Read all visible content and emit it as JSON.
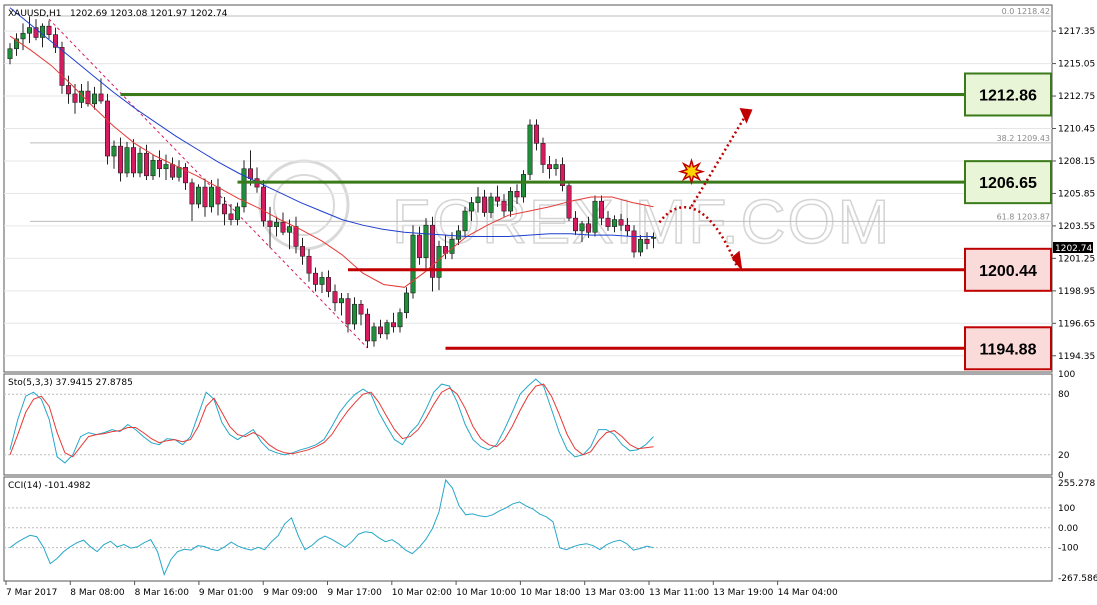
{
  "header": {
    "symbol": "XAUUSD,H1",
    "ohlc": "1202.69 1203.08 1201.97 1202.74",
    "current_price": "1202.74"
  },
  "watermark": "FOREXIMF.COM",
  "colors": {
    "bull": "#1f8f3a",
    "bear": "#d81b60",
    "ma_fast": "#e53935",
    "ma_slow": "#1e3fd0",
    "support": "#c00000",
    "resistance": "#3a7a1a",
    "stoch_main": "#26a7c9",
    "stoch_signal": "#e53935",
    "cci": "#26a7c9"
  },
  "levels": [
    {
      "label": "1212.86",
      "value": 1212.86,
      "kind": "resistance"
    },
    {
      "label": "1206.65",
      "value": 1206.65,
      "kind": "resistance"
    },
    {
      "label": "1200.44",
      "value": 1200.44,
      "kind": "support"
    },
    {
      "label": "1194.88",
      "value": 1194.88,
      "kind": "support"
    }
  ],
  "fib_labels": [
    {
      "text": "0.0  1218.42",
      "value": 1218.42
    },
    {
      "text": "38.2  1209.43",
      "value": 1209.43
    },
    {
      "text": "61.8  1203.87",
      "value": 1203.87
    }
  ],
  "stoch_header": "Sto(5,3,3) 37.9415 27.8785",
  "cci_header": "CCI(14) -101.4982",
  "x_ticks": [
    "7 Mar 2017",
    "8 Mar 08:00",
    "8 Mar 16:00",
    "9 Mar 01:00",
    "9 Mar 09:00",
    "9 Mar 17:00",
    "10 Mar 02:00",
    "10 Mar 10:00",
    "10 Mar 18:00",
    "13 Mar 03:00",
    "13 Mar 11:00",
    "13 Mar 19:00",
    "14 Mar 04:00"
  ],
  "chart_data": {
    "type": "candlestick",
    "symbol": "XAUUSD",
    "timeframe": "H1",
    "price_axis": {
      "ylim": [
        1193.2,
        1219.2
      ],
      "ticks": [
        "1217.35",
        "1215.05",
        "1212.75",
        "1210.45",
        "1208.15",
        "1205.85",
        "1203.55",
        "1201.25",
        "1198.95",
        "1196.65",
        "1194.35"
      ]
    },
    "candles": [
      [
        1215.4,
        1216.5,
        1215.0,
        1216.1
      ],
      [
        1216.1,
        1217.2,
        1215.6,
        1216.8
      ],
      [
        1216.8,
        1217.9,
        1216.0,
        1217.2
      ],
      [
        1217.2,
        1218.4,
        1216.5,
        1217.6
      ],
      [
        1217.6,
        1218.2,
        1216.7,
        1216.9
      ],
      [
        1216.9,
        1217.9,
        1216.2,
        1217.7
      ],
      [
        1217.7,
        1218.1,
        1216.8,
        1217.1
      ],
      [
        1217.1,
        1217.6,
        1215.8,
        1216.2
      ],
      [
        1216.2,
        1216.6,
        1212.9,
        1213.5
      ],
      [
        1213.5,
        1214.2,
        1212.2,
        1212.9
      ],
      [
        1212.9,
        1213.6,
        1211.5,
        1212.3
      ],
      [
        1212.3,
        1213.6,
        1211.9,
        1213.1
      ],
      [
        1213.1,
        1213.8,
        1212.0,
        1212.2
      ],
      [
        1212.2,
        1213.4,
        1211.8,
        1212.9
      ],
      [
        1212.9,
        1214.0,
        1212.2,
        1212.4
      ],
      [
        1212.4,
        1212.9,
        1207.9,
        1208.5
      ],
      [
        1208.5,
        1209.6,
        1207.6,
        1209.2
      ],
      [
        1209.2,
        1209.8,
        1206.7,
        1207.3
      ],
      [
        1207.3,
        1209.5,
        1207.0,
        1209.1
      ],
      [
        1209.1,
        1209.7,
        1207.0,
        1207.3
      ],
      [
        1207.3,
        1209.1,
        1207.0,
        1208.7
      ],
      [
        1208.7,
        1209.3,
        1206.8,
        1207.1
      ],
      [
        1207.1,
        1208.6,
        1206.8,
        1208.2
      ],
      [
        1208.2,
        1208.9,
        1207.0,
        1207.6
      ],
      [
        1207.6,
        1208.6,
        1206.8,
        1207.9
      ],
      [
        1207.9,
        1208.4,
        1206.8,
        1207.0
      ],
      [
        1207.0,
        1208.2,
        1206.7,
        1207.7
      ],
      [
        1207.7,
        1208.0,
        1206.1,
        1206.6
      ],
      [
        1206.6,
        1206.9,
        1203.9,
        1205.1
      ],
      [
        1205.1,
        1206.5,
        1204.8,
        1206.3
      ],
      [
        1206.3,
        1206.9,
        1204.2,
        1204.9
      ],
      [
        1204.9,
        1206.8,
        1204.5,
        1206.3
      ],
      [
        1206.3,
        1206.9,
        1204.3,
        1205.1
      ],
      [
        1205.1,
        1205.6,
        1203.6,
        1204.4
      ],
      [
        1204.4,
        1205.1,
        1203.6,
        1204.0
      ],
      [
        1204.0,
        1205.2,
        1203.6,
        1204.9
      ],
      [
        1204.9,
        1208.2,
        1204.5,
        1207.6
      ],
      [
        1207.6,
        1208.9,
        1206.4,
        1206.9
      ],
      [
        1206.9,
        1207.7,
        1205.9,
        1206.3
      ],
      [
        1206.3,
        1206.8,
        1203.5,
        1203.9
      ],
      [
        1203.9,
        1204.9,
        1202.0,
        1203.5
      ],
      [
        1203.5,
        1204.2,
        1202.8,
        1203.8
      ],
      [
        1203.8,
        1204.5,
        1202.9,
        1203.1
      ],
      [
        1203.1,
        1204.0,
        1201.9,
        1203.5
      ],
      [
        1203.5,
        1204.2,
        1201.6,
        1202.1
      ],
      [
        1202.1,
        1202.7,
        1200.8,
        1201.4
      ],
      [
        1201.4,
        1201.9,
        1199.6,
        1200.2
      ],
      [
        1200.2,
        1200.6,
        1198.9,
        1199.4
      ],
      [
        1199.4,
        1200.3,
        1198.8,
        1199.9
      ],
      [
        1199.9,
        1200.4,
        1198.5,
        1198.9
      ],
      [
        1198.9,
        1199.4,
        1197.5,
        1198.1
      ],
      [
        1198.1,
        1198.8,
        1197.2,
        1198.4
      ],
      [
        1198.4,
        1198.8,
        1196.0,
        1196.6
      ],
      [
        1196.6,
        1198.5,
        1196.2,
        1198.0
      ],
      [
        1198.0,
        1198.3,
        1196.5,
        1197.3
      ],
      [
        1197.3,
        1197.7,
        1194.9,
        1195.4
      ],
      [
        1195.4,
        1196.7,
        1195.0,
        1196.4
      ],
      [
        1196.4,
        1196.9,
        1195.6,
        1195.9
      ],
      [
        1195.9,
        1196.9,
        1195.5,
        1196.7
      ],
      [
        1196.7,
        1197.4,
        1196.0,
        1196.4
      ],
      [
        1196.4,
        1197.7,
        1196.0,
        1197.4
      ],
      [
        1197.4,
        1199.2,
        1197.0,
        1198.8
      ],
      [
        1198.8,
        1203.6,
        1198.4,
        1202.9
      ],
      [
        1202.9,
        1203.5,
        1200.8,
        1201.3
      ],
      [
        1201.3,
        1204.1,
        1200.5,
        1203.6
      ],
      [
        1203.6,
        1204.2,
        1198.9,
        1199.9
      ],
      [
        1199.9,
        1202.5,
        1199.0,
        1202.1
      ],
      [
        1202.1,
        1202.9,
        1201.2,
        1201.6
      ],
      [
        1201.6,
        1203.1,
        1201.2,
        1202.6
      ],
      [
        1202.6,
        1203.6,
        1202.2,
        1203.2
      ],
      [
        1203.2,
        1204.9,
        1202.8,
        1204.6
      ],
      [
        1204.6,
        1205.6,
        1203.9,
        1205.2
      ],
      [
        1205.2,
        1206.3,
        1204.5,
        1205.6
      ],
      [
        1205.6,
        1206.1,
        1204.2,
        1204.5
      ],
      [
        1204.5,
        1205.9,
        1204.1,
        1205.6
      ],
      [
        1205.6,
        1206.4,
        1204.9,
        1205.3
      ],
      [
        1205.3,
        1205.8,
        1204.2,
        1204.6
      ],
      [
        1204.6,
        1206.3,
        1204.2,
        1206.0
      ],
      [
        1206.0,
        1206.5,
        1205.1,
        1205.6
      ],
      [
        1205.6,
        1207.5,
        1205.2,
        1207.2
      ],
      [
        1207.2,
        1211.1,
        1206.8,
        1210.7
      ],
      [
        1210.7,
        1211.1,
        1208.9,
        1209.4
      ],
      [
        1209.4,
        1209.8,
        1207.3,
        1207.9
      ],
      [
        1207.9,
        1208.5,
        1206.9,
        1207.6
      ],
      [
        1207.6,
        1208.3,
        1207.1,
        1207.9
      ],
      [
        1207.9,
        1208.4,
        1206.0,
        1206.4
      ],
      [
        1206.4,
        1206.7,
        1203.9,
        1204.1
      ],
      [
        1204.1,
        1204.6,
        1202.9,
        1203.2
      ],
      [
        1203.2,
        1203.9,
        1202.4,
        1203.7
      ],
      [
        1203.7,
        1204.2,
        1202.7,
        1203.1
      ],
      [
        1203.1,
        1205.7,
        1202.8,
        1205.3
      ],
      [
        1205.3,
        1205.7,
        1203.6,
        1204.1
      ],
      [
        1204.1,
        1204.6,
        1203.2,
        1203.5
      ],
      [
        1203.5,
        1204.3,
        1203.1,
        1204.0
      ],
      [
        1204.0,
        1204.4,
        1203.2,
        1203.6
      ],
      [
        1203.6,
        1204.1,
        1202.8,
        1203.2
      ],
      [
        1203.2,
        1203.6,
        1201.3,
        1201.7
      ],
      [
        1201.7,
        1202.9,
        1201.4,
        1202.6
      ],
      [
        1202.6,
        1203.1,
        1201.9,
        1202.3
      ],
      [
        1202.69,
        1203.08,
        1201.97,
        1202.74
      ]
    ],
    "ma_fast": [
      1217.0,
      1216.0,
      1214.9,
      1213.5,
      1212.0,
      1210.6,
      1209.4,
      1208.5,
      1207.8,
      1207.1,
      1206.3,
      1205.5,
      1204.8,
      1204.0,
      1203.3,
      1202.5,
      1201.5,
      1200.2,
      1199.4,
      1199.2,
      1200.3,
      1201.6,
      1202.8,
      1203.6,
      1204.3,
      1204.6,
      1204.9,
      1205.3,
      1205.6,
      1205.6,
      1205.2,
      1204.9
    ],
    "ma_slow": [
      1219.0,
      1217.8,
      1216.6,
      1215.4,
      1214.2,
      1213.0,
      1211.9,
      1210.9,
      1209.9,
      1209.0,
      1208.1,
      1207.3,
      1206.6,
      1205.9,
      1205.2,
      1204.6,
      1204.0,
      1203.6,
      1203.3,
      1203.1,
      1203.0,
      1202.9,
      1202.8,
      1202.8,
      1202.8,
      1202.9,
      1203.0,
      1203.0,
      1202.9,
      1202.9,
      1202.8,
      1202.8
    ],
    "stochastic": {
      "label": "Sto(5,3,3)",
      "main": 37.9415,
      "signal": 27.8785,
      "ylim": [
        0,
        100
      ],
      "ticks": [
        "100",
        "80",
        "20",
        "0"
      ],
      "main_series": [
        25,
        55,
        78,
        82,
        75,
        55,
        18,
        12,
        20,
        38,
        42,
        40,
        42,
        45,
        43,
        50,
        45,
        38,
        32,
        30,
        36,
        35,
        30,
        38,
        60,
        82,
        75,
        52,
        40,
        35,
        40,
        45,
        33,
        25,
        22,
        20,
        22,
        25,
        27,
        30,
        35,
        48,
        62,
        72,
        80,
        85,
        80,
        62,
        48,
        35,
        30,
        42,
        50,
        65,
        82,
        90,
        88,
        72,
        50,
        35,
        28,
        25,
        30,
        45,
        62,
        80,
        88,
        95,
        88,
        65,
        42,
        25,
        18,
        20,
        28,
        45,
        45,
        40,
        30,
        24,
        25,
        30,
        38
      ],
      "signal_series": [
        20,
        40,
        62,
        75,
        78,
        68,
        42,
        22,
        18,
        28,
        38,
        40,
        41,
        43,
        44,
        47,
        47,
        42,
        36,
        32,
        34,
        35,
        33,
        35,
        48,
        68,
        76,
        62,
        48,
        40,
        38,
        42,
        38,
        30,
        25,
        22,
        21,
        23,
        25,
        28,
        32,
        40,
        52,
        63,
        72,
        80,
        82,
        72,
        58,
        45,
        36,
        38,
        45,
        56,
        70,
        82,
        86,
        80,
        66,
        48,
        36,
        30,
        28,
        35,
        48,
        64,
        78,
        88,
        90,
        78,
        60,
        40,
        26,
        20,
        23,
        34,
        42,
        44,
        38,
        30,
        26,
        27,
        28
      ]
    },
    "cci": {
      "label": "CCI(14)",
      "value": -101.4982,
      "ylim": [
        -267.5868,
        255.278
      ],
      "ticks": [
        "255.278",
        "100",
        "0.00",
        "-100",
        "-267.5868"
      ],
      "series": [
        -100,
        -75,
        -55,
        -38,
        -45,
        -98,
        -180,
        -155,
        -120,
        -95,
        -75,
        -62,
        -95,
        -120,
        -85,
        -68,
        -96,
        -84,
        -102,
        -96,
        -75,
        -60,
        -120,
        -235,
        -160,
        -120,
        -108,
        -112,
        -90,
        -94,
        -108,
        -115,
        -96,
        -72,
        -92,
        -104,
        -112,
        -98,
        -110,
        -70,
        -40,
        20,
        50,
        -40,
        -110,
        -90,
        -60,
        -42,
        -58,
        -78,
        -98,
        -70,
        -32,
        -20,
        -25,
        -50,
        -70,
        -60,
        -82,
        -112,
        -130,
        -100,
        -60,
        -5,
        80,
        240,
        200,
        110,
        65,
        70,
        60,
        55,
        65,
        85,
        100,
        120,
        130,
        110,
        95,
        70,
        55,
        30,
        -100,
        -110,
        -95,
        -85,
        -80,
        -90,
        -110,
        -85,
        -70,
        -62,
        -80,
        -112,
        -104,
        -92,
        -100
      ]
    }
  }
}
